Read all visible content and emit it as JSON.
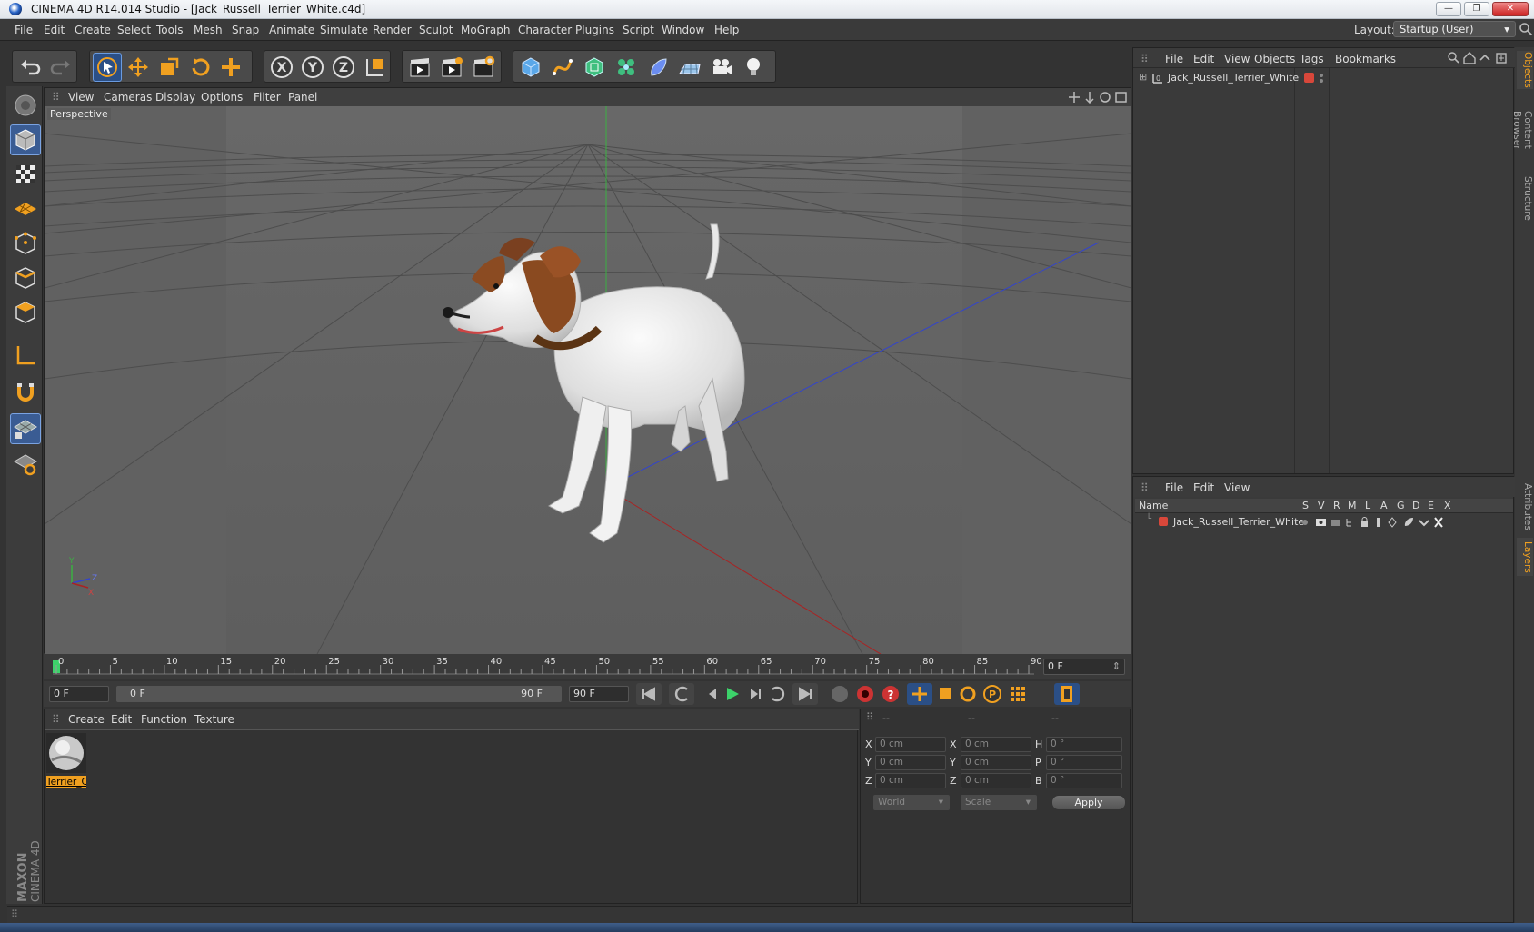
{
  "window": {
    "title": "CINEMA 4D R14.014 Studio - [Jack_Russell_Terrier_White.c4d]",
    "minimize": "—",
    "maximize": "❐",
    "close": "✕"
  },
  "menubar": {
    "items": [
      "File",
      "Edit",
      "Create",
      "Select",
      "Tools",
      "Mesh",
      "Snap",
      "Animate",
      "Simulate",
      "Render",
      "Sculpt",
      "MoGraph",
      "Character",
      "Plugins",
      "Script",
      "Window",
      "Help"
    ],
    "layout_label": "Layout:",
    "layout_value": "Startup (User)"
  },
  "viewport": {
    "menu": [
      "View",
      "Cameras",
      "Display",
      "Options",
      "Filter",
      "Panel"
    ],
    "camera_label": "Perspective",
    "axis_labels": {
      "x": "X",
      "y": "Y",
      "z": "Z"
    }
  },
  "timeline": {
    "ticks": [
      "0",
      "5",
      "10",
      "15",
      "20",
      "25",
      "30",
      "35",
      "40",
      "45",
      "50",
      "55",
      "60",
      "65",
      "70",
      "75",
      "80",
      "85",
      "90"
    ],
    "current_frame": "0 F",
    "start_field": "0 F",
    "range_start": "0 F",
    "range_end": "90 F",
    "end_field": "90 F"
  },
  "materials": {
    "menu": [
      "Create",
      "Edit",
      "Function",
      "Texture"
    ],
    "items": [
      {
        "name": "Terrier_C"
      }
    ]
  },
  "coordinates": {
    "headers": [
      "--",
      "--",
      "--"
    ],
    "rows": [
      {
        "a": "X",
        "av": "0 cm",
        "b": "X",
        "bv": "0 cm",
        "c": "H",
        "cv": "0 °"
      },
      {
        "a": "Y",
        "av": "0 cm",
        "b": "Y",
        "bv": "0 cm",
        "c": "P",
        "cv": "0 °"
      },
      {
        "a": "Z",
        "av": "0 cm",
        "b": "Z",
        "bv": "0 cm",
        "c": "B",
        "cv": "0 °"
      }
    ],
    "world_select": "World",
    "scale_select": "Scale",
    "apply_label": "Apply"
  },
  "objects": {
    "menu": [
      "File",
      "Edit",
      "View",
      "Objects",
      "Tags",
      "Bookmarks"
    ],
    "items": [
      {
        "name": "Jack_Russell_Terrier_White",
        "color": "#d8473a"
      }
    ]
  },
  "layers": {
    "menu": [
      "File",
      "Edit",
      "View"
    ],
    "columns": [
      "Name",
      "S",
      "V",
      "R",
      "M",
      "L",
      "A",
      "G",
      "D",
      "E",
      "X"
    ],
    "items": [
      {
        "name": "Jack_Russell_Terrier_White",
        "color": "#d8473a"
      }
    ]
  },
  "side_tabs": [
    "Objects",
    "Content Browser",
    "Structure",
    "Attributes",
    "Layers"
  ],
  "brand": {
    "maxon": "MAXON",
    "product": "CINEMA 4D"
  },
  "colors": {
    "accent": "#f0a020",
    "active_blue": "#2b4f86",
    "object_red": "#d8473a"
  }
}
